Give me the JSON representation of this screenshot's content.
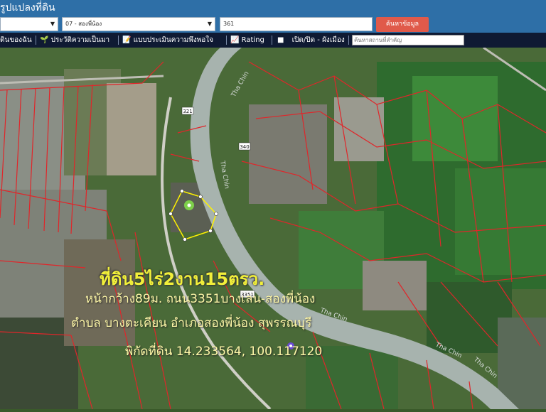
{
  "header": {
    "title": "รูปแปลงที่ดิน",
    "district_select_value": "07 - สองพี่น้อง",
    "parcel_input_value": "361",
    "search_label": "ค้นหาข้อมูล"
  },
  "nav": {
    "my_land": "ดินของฉัน",
    "history": "ประวัติความเป็นมา",
    "survey": "แบบประเมินความพึงพอใจ",
    "rating": "Rating",
    "toggle_layer": "เปิด/ปิด - ผังเมือง",
    "place_placeholder": "ค้นหาสถานที่สำคัญ"
  },
  "map": {
    "river_labels": [
      "Tha Chin",
      "Tha Chin",
      "Tha Chin",
      "Tha Chin",
      "Tha Chin"
    ],
    "road_shields": [
      "321",
      "340",
      "3351"
    ],
    "overlay": {
      "line1": "ที่ดิน5ไร่2งาน15ตรว.",
      "line2": "หน้ากว้าง89ม. ถนน3351บางเลน-สองพี่น้อง",
      "line3": "ตำบล บางตะเคียน อำเภอสองพี่น้อง สุพรรณบุรี",
      "line4": "พิกัดที่ดิน 14.233564, 100.117120"
    }
  },
  "colors": {
    "topbar": "#2e6fa7",
    "navbar": "#0f1a33",
    "search_button": "#e05a4a",
    "parcel_lines": "#e0262a",
    "overlay_title": "#f1ef3a"
  }
}
